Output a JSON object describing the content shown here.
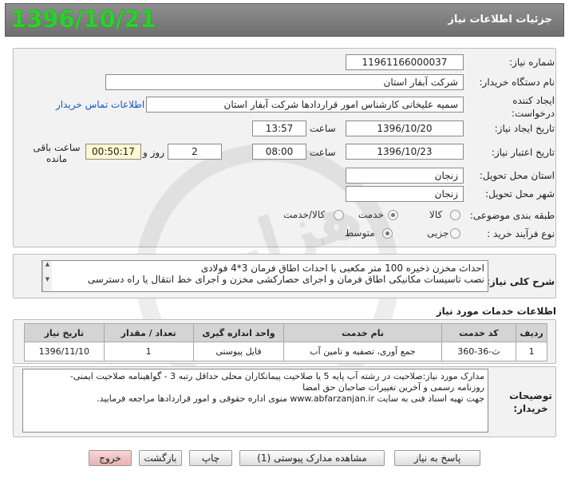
{
  "header": {
    "title": "جزئیات اطلاعات نیاز",
    "date_stamp": "1396/10/21"
  },
  "fields": {
    "need_number_label": "شماره نیاز:",
    "need_number": "1196116600003­7",
    "buyer_org_label": "نام دستگاه خریدار:",
    "buyer_org": "شرکت آبفار استان",
    "creator_label": "ایجاد کننده درخواست:",
    "creator": "سمیه علیخانی کارشناس امور قراردادها  شرکت آبفار استان",
    "buyer_contact_link": "اطلاعات تماس خریدار",
    "created_date_label": "تاریخ ایجاد نیاز:",
    "created_date": "1396/10/20",
    "created_time_label": "ساعت",
    "created_time": "13:57",
    "validity_date_label": "تاریخ اعتبار نیاز:",
    "validity_date": "1396/10/23",
    "validity_time_label": "ساعت",
    "validity_time": "08:00",
    "days_value": "2",
    "days_label": "روز و",
    "remaining_time": "00:50:17",
    "remaining_label": "ساعت باقی مانده",
    "delivery_province_label": "استان محل تحویل:",
    "delivery_province": "زنجان",
    "delivery_city_label": "شهر محل تحویل:",
    "delivery_city": "زنجان",
    "category_label": "طبقه بندی موضوعی:",
    "category_options": [
      "کالا",
      "خدمت",
      "کالا/خدمت"
    ],
    "category_selected": "خدمت",
    "process_label": "نوع فرآیند خرید :",
    "process_options": [
      "جزیی",
      "متوسط"
    ],
    "process_selected": "متوسط"
  },
  "description": {
    "label": "شرح کلی نیاز:",
    "line1": "احداث مخزن ذخیره 100 متر مکعبی با احداث اطاق فرمان 3*4 فولادی",
    "line2": "نصب تاسیسات مکانیکی اطاق فرمان و اجرای حصارکشی مخزن و اجرای خط انتقال یا راه دسترسی"
  },
  "services": {
    "title": "اطلاعات خدمات مورد نیاز",
    "columns": [
      "ردیف",
      "کد خدمت",
      "نام خدمت",
      "واحد اندازه گیری",
      "تعداد / مقدار",
      "تاریخ نیاز"
    ],
    "rows": [
      [
        "1",
        "ث-36-360",
        "جمع آوری، تصفیه و تامین آب",
        "فایل پیوستی",
        "1",
        "1396/11/10"
      ]
    ]
  },
  "notes": {
    "label": "توضیحات خریدار:",
    "line1": "مدارک مورد نیاز:صلاحیت در رشته آب پایه 5 یا صلاحیت پیمانکاران محلی حداقل رتبه 3 - گواهینامه صلاحیت ایمنی-",
    "line2": "روزنامه رسمی و آخرین تغییرات صاحبان حق امضا",
    "line3": "جهت تهیه اسناد فنی به سایت www.abfarzanjan.ir  منوی اداره حقوقی و امور قراردادها مراجعه فرمایید."
  },
  "buttons": {
    "reply": "پاسخ به نیاز",
    "attachments": "مشاهده مدارک پیوستی (1)",
    "print": "چاپ",
    "back": "بازگشت",
    "exit": "خروج"
  },
  "watermark": {
    "text": "هزاره"
  },
  "colors": {
    "header_bg": "#7f7f7f",
    "date_stamp": "#2bd12b",
    "link": "#1a55c8",
    "exit_button": "#e8b1b1"
  }
}
